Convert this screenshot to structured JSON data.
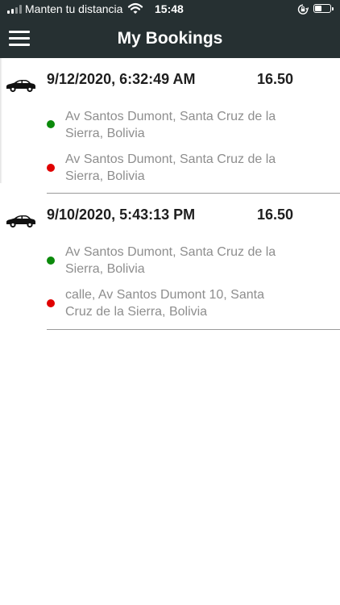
{
  "status_bar": {
    "carrier": "Manten tu distancia",
    "time": "15:48",
    "signal_icon": "signal-icon",
    "wifi_icon": "wifi-icon",
    "orientation_lock_icon": "orientation-lock-icon",
    "battery_icon": "battery-icon",
    "battery_level": 0.45
  },
  "header": {
    "title": "My Bookings",
    "menu_icon": "hamburger-icon",
    "background": "#263032"
  },
  "bookings": [
    {
      "datetime": "9/12/2020, 6:32:49 AM",
      "price": "16.50",
      "pickup": "Av Santos Dumont, Santa Cruz de la Sierra, Bolivia",
      "dropoff": "Av Santos Dumont, Santa Cruz de la Sierra, Bolivia"
    },
    {
      "datetime": "9/10/2020, 5:43:13 PM",
      "price": "16.50",
      "pickup": "Av Santos Dumont, Santa Cruz de la Sierra, Bolivia",
      "dropoff": "calle, Av Santos Dumont 10, Santa Cruz de la Sierra, Bolivia"
    }
  ],
  "colors": {
    "pickup_dot": "#0b8a0b",
    "dropoff_dot": "#e00000",
    "address_text": "#8e8e8e"
  }
}
